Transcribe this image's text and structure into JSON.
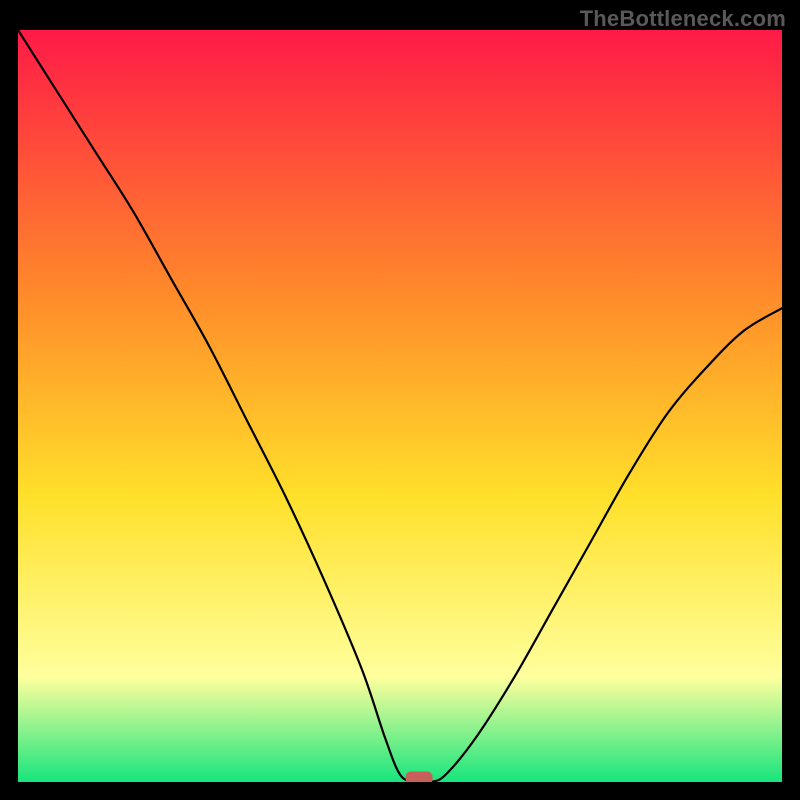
{
  "watermark": "TheBottleneck.com",
  "colors": {
    "gradient_top": "#ff1a47",
    "gradient_mid1": "#ff8a2a",
    "gradient_mid2": "#ffe02a",
    "gradient_low": "#ffff9d",
    "gradient_bottom": "#17e57d",
    "curve": "#000000",
    "marker": "#c75f5a",
    "frame": "#000000"
  },
  "chart_data": {
    "type": "line",
    "title": "",
    "xlabel": "",
    "ylabel": "",
    "x": [
      0.0,
      0.05,
      0.1,
      0.15,
      0.2,
      0.25,
      0.3,
      0.35,
      0.4,
      0.45,
      0.48,
      0.5,
      0.52,
      0.54,
      0.56,
      0.6,
      0.65,
      0.7,
      0.75,
      0.8,
      0.85,
      0.9,
      0.95,
      1.0
    ],
    "values": [
      100,
      92,
      84,
      76,
      67,
      58,
      48,
      38,
      27,
      15,
      6,
      1,
      0,
      0,
      1,
      6,
      14,
      23,
      32,
      41,
      49,
      55,
      60,
      63
    ],
    "xlim": [
      0,
      1
    ],
    "ylim": [
      0,
      100
    ],
    "marker": {
      "x": 0.525,
      "y": 0
    },
    "annotations": []
  }
}
